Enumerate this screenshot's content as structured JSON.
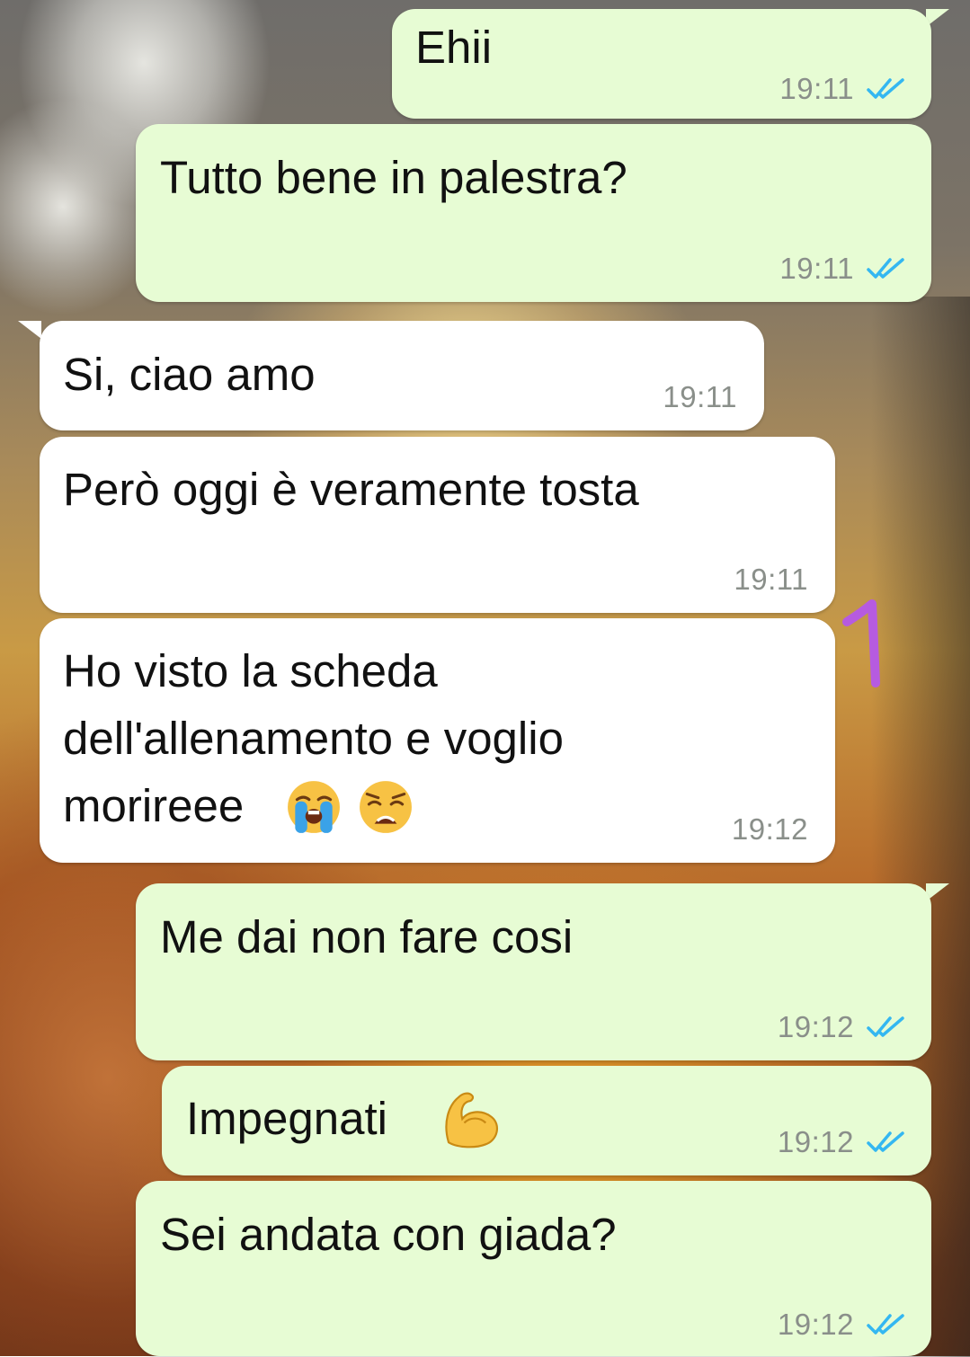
{
  "chat": {
    "messages": [
      {
        "direction": "outgoing",
        "text": "Ehii",
        "time": "19:11",
        "status": "read"
      },
      {
        "direction": "outgoing",
        "text": "Tutto bene in palestra?",
        "time": "19:11",
        "status": "read"
      },
      {
        "direction": "incoming",
        "text": "Si, ciao amo",
        "time": "19:11"
      },
      {
        "direction": "incoming",
        "text": "Però oggi è veramente tosta",
        "time": "19:11"
      },
      {
        "direction": "incoming",
        "text_line1": "Ho visto la scheda",
        "text_line2": "dell'allenamento e voglio",
        "text_line3": "morireee",
        "emojis": [
          "loudly-crying-face-emoji",
          "weary-face-emoji"
        ],
        "time": "19:12"
      },
      {
        "direction": "outgoing",
        "text": "Me dai non fare cosi",
        "time": "19:12",
        "status": "read"
      },
      {
        "direction": "outgoing",
        "text": "Impegnati",
        "emojis": [
          "flexed-biceps-emoji"
        ],
        "time": "19:12",
        "status": "read"
      },
      {
        "direction": "outgoing",
        "text": "Sei andata con giada?",
        "time": "19:12",
        "status": "read"
      }
    ],
    "annotation": "1"
  },
  "colors": {
    "outgoing_bubble": "#e7fcd4",
    "incoming_bubble": "#ffffff",
    "read_ticks": "#34b7f1",
    "annotation": "#b65be0"
  },
  "icons": [
    "double-check-icon",
    "loudly-crying-face-emoji",
    "weary-face-emoji",
    "flexed-biceps-emoji"
  ]
}
